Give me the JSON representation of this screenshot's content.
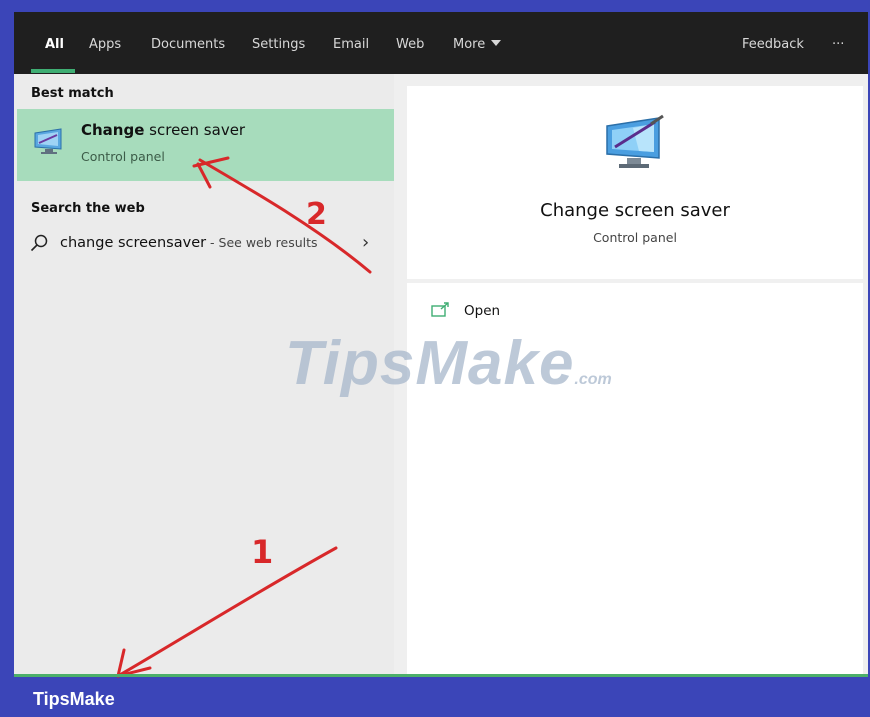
{
  "tabs": [
    {
      "label": "All",
      "active": true
    },
    {
      "label": "Apps"
    },
    {
      "label": "Documents"
    },
    {
      "label": "Settings"
    },
    {
      "label": "Email"
    },
    {
      "label": "Web"
    },
    {
      "label": "More"
    }
  ],
  "feedback": "Feedback",
  "overflow": "···",
  "left": {
    "best_match_heading": "Best match",
    "best_match": {
      "title_bold": "Change",
      "title_rest": " screen saver",
      "subtitle": "Control panel",
      "icon": "screen-saver-monitor-icon"
    },
    "web_heading": "Search the web",
    "web_result": {
      "query": "change screensaver",
      "suffix": " - See web results",
      "chevron": "›"
    }
  },
  "preview": {
    "title": "Change screen saver",
    "subtitle": "Control panel",
    "icon": "screen-saver-monitor-icon"
  },
  "actions": {
    "open_label": "Open"
  },
  "watermark": {
    "main": "TipsMake",
    "suffix": ".com"
  },
  "annotations": {
    "step1": "1",
    "step2": "2",
    "color": "#d8282a"
  },
  "footer": {
    "brand": "TipsMake"
  },
  "colors": {
    "accent": "#3fae73",
    "highlight": "#a7dcbc",
    "frame": "#3b45b8",
    "tabbar": "#1f1f1f"
  }
}
